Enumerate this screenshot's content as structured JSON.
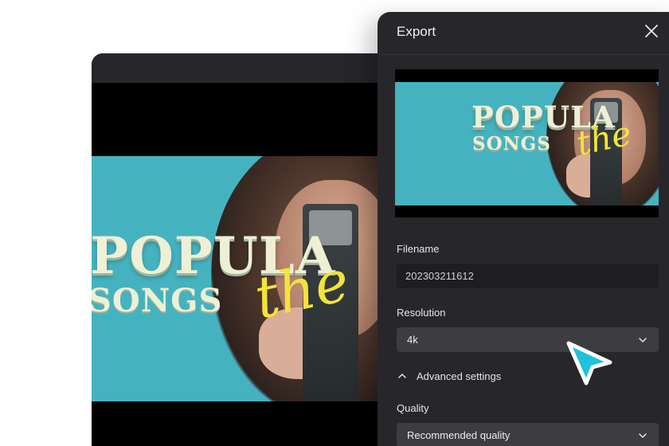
{
  "export_panel": {
    "title": "Export",
    "filename_label": "Filename",
    "filename_value": "202303211612",
    "resolution_label": "Resolution",
    "resolution_value": "4k",
    "advanced_label": "Advanced settings",
    "quality_label": "Quality",
    "quality_value": "Recommended quality"
  },
  "video": {
    "title_text": "POPULA",
    "subtitle_text": "SONGS",
    "script_text": "the"
  },
  "colors": {
    "panel_bg": "#27272b",
    "video_bg": "#45b3bf",
    "cursor": "#1fc2d8",
    "title_text": "#eef0d6",
    "script_text": "#f2e43a"
  },
  "icons": {
    "close": "close-icon",
    "chevron_down": "chevron-down-icon",
    "chevron_up": "chevron-up-icon",
    "cursor": "cursor-pointer-icon"
  }
}
